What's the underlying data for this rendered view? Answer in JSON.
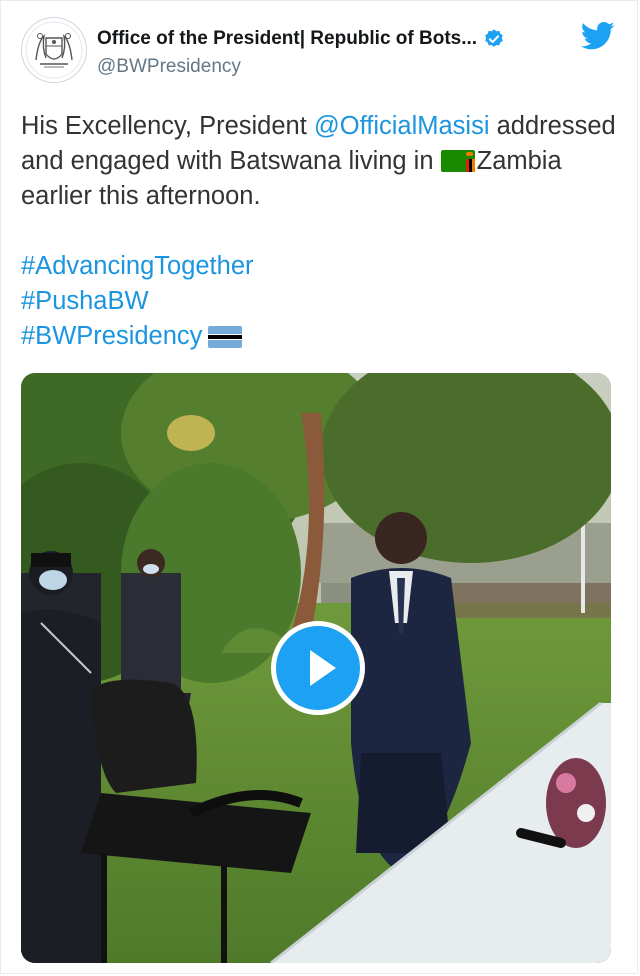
{
  "tweet": {
    "author": {
      "display_name": "Office of the President| Republic of Bots...",
      "handle": "@BWPresidency",
      "avatar_icon": "botswana-coat-of-arms-icon",
      "verified_icon": "verified-badge-icon"
    },
    "brand_icon": "twitter-bird-icon",
    "text": {
      "line1_prefix": "His Excellency, President ",
      "mention": "@OfficialMasisi",
      "line1_suffix": " addressed and engaged with Batswana living in ",
      "zambia_flag_icon": "zambia-flag-icon",
      "line1_end": "Zambia earlier this afternoon.",
      "hashtags": [
        "#AdvancingTogether",
        "#PushaBW",
        "#BWPresidency"
      ],
      "botswana_flag_icon": "botswana-flag-icon"
    },
    "media": {
      "type": "video",
      "play_icon": "play-icon"
    }
  },
  "colors": {
    "link": "#1b95e0",
    "twitter_blue": "#1da1f2",
    "text": "#333333",
    "secondary": "#657786"
  }
}
